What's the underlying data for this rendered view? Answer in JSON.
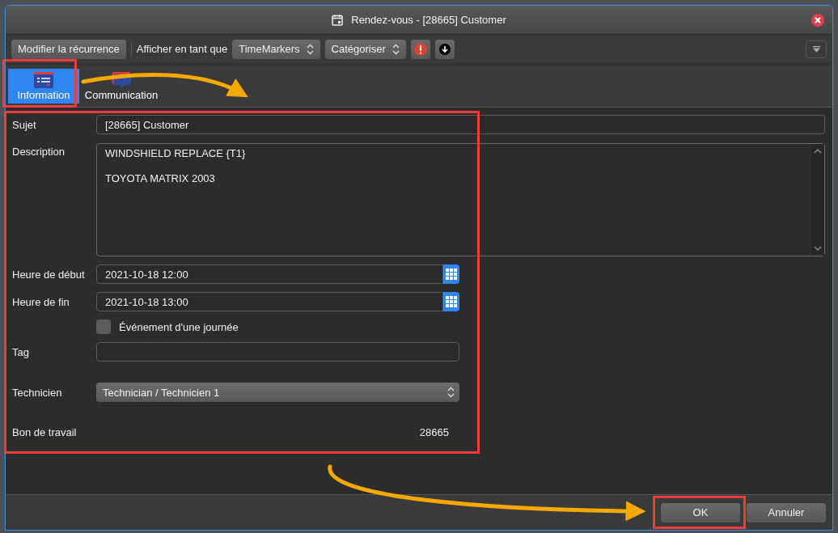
{
  "window": {
    "title": "Rendez-vous - [28665] Customer"
  },
  "toolbar": {
    "recurrence_button": "Modifier la récurrence",
    "display_label": "Afficher en tant que",
    "display_select": "TimeMarkers",
    "categorize_select": "Catégoriser"
  },
  "tabs": [
    {
      "label": "Information",
      "selected": true
    },
    {
      "label": "Communication",
      "selected": false
    }
  ],
  "form": {
    "subject": {
      "label": "Sujet",
      "value": "[28665] Customer"
    },
    "description": {
      "label": "Description",
      "value": "WINDSHIELD REPLACE {T1}\n\nTOYOTA MATRIX 2003"
    },
    "start": {
      "label": "Heure de début",
      "value": "2021-10-18 12:00"
    },
    "end": {
      "label": "Heure de fin",
      "value": "2021-10-18 13:00"
    },
    "all_day": {
      "label": "Événement d'une journée",
      "checked": false
    },
    "tag": {
      "label": "Tag"
    },
    "technician": {
      "label": "Technicien",
      "value": "Technician / Technicien 1"
    },
    "work_order": {
      "label": "Bon de travail",
      "value": "28665"
    }
  },
  "buttons": [
    {
      "label": "OK"
    },
    {
      "label": "Annuler"
    }
  ]
}
